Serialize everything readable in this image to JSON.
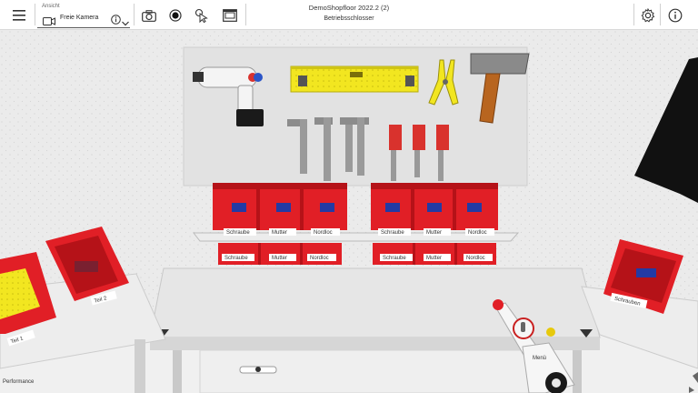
{
  "toolbar": {
    "view_label": "Ansicht",
    "camera_mode": "Freie Kamera",
    "document_title": "DemoShopfloor 2022.2 (2)",
    "document_subtitle": "Betriebsschlosser"
  },
  "scene": {
    "upper_left_labels": [
      "Schraube",
      "Mutter",
      "Nordloc"
    ],
    "upper_right_labels": [
      "Schraube",
      "Mutter",
      "Nordloc"
    ],
    "lower_left_labels": [
      "Schraube",
      "Mutter",
      "Nordloc"
    ],
    "lower_right_labels": [
      "Schraube",
      "Mutter",
      "Nordloc"
    ],
    "left_bin_labels": [
      "Teil 1",
      "Teil 2"
    ],
    "right_bin_label": "Schrauben",
    "controller_label": "Menü"
  },
  "footer": {
    "performance_label": "Performance"
  },
  "colors": {
    "bin_red": "#e11f26",
    "wall": "#e6e6e6",
    "toolbar": "#ffffff"
  }
}
